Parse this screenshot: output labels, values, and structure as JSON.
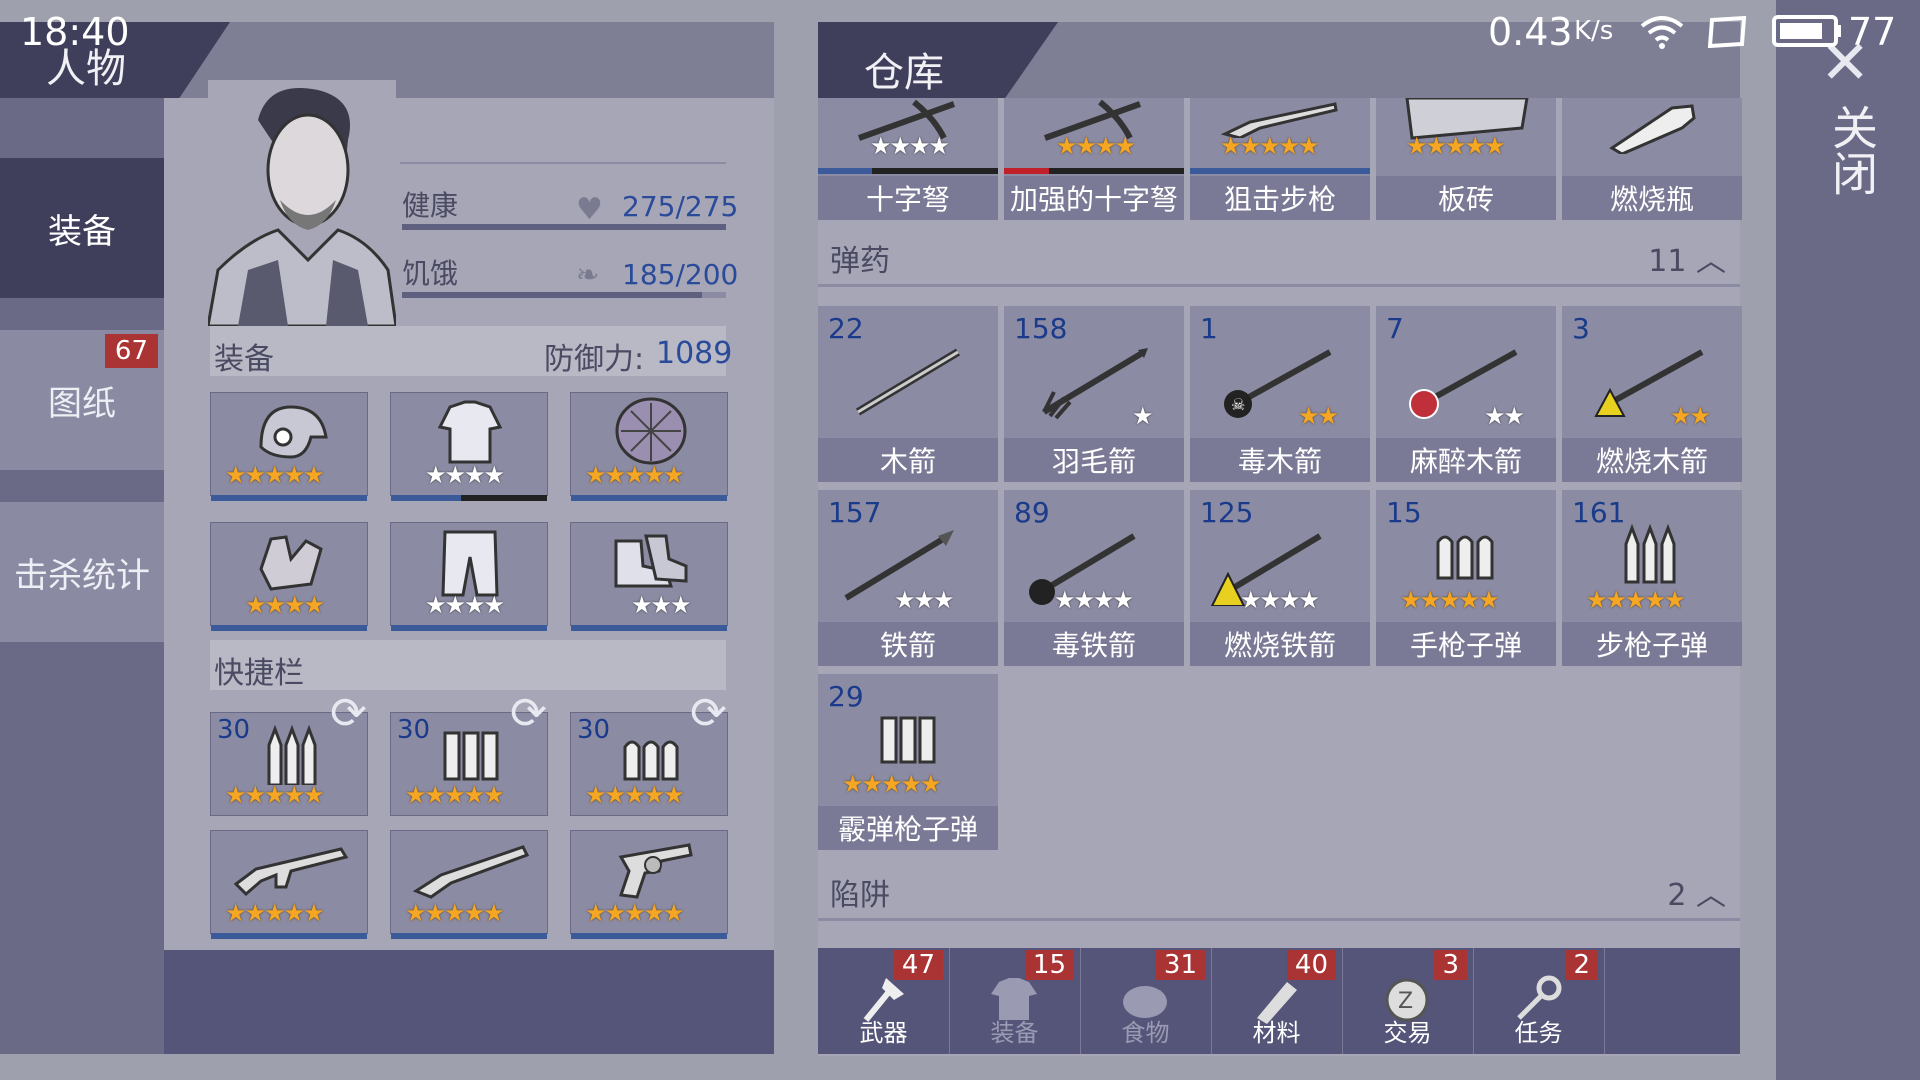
{
  "status_bar": {
    "time": "18:40",
    "speed": "0.43",
    "speed_unit": "K/s",
    "battery": "77"
  },
  "left": {
    "title": "人物",
    "tabs": [
      {
        "label": "装备",
        "badge": ""
      },
      {
        "label": "图纸",
        "badge": "67"
      },
      {
        "label": "击杀统计",
        "badge": ""
      }
    ],
    "health_label": "健康",
    "health_value": "275/275",
    "hunger_label": "饥饿",
    "hunger_value": "185/200",
    "equip_label": "装备",
    "defense_label": "防御力:",
    "defense_value": "1089",
    "equipment": [
      {
        "icon": "helmet-icon",
        "stars": "★★★★★",
        "gold": true
      },
      {
        "icon": "shirt-icon",
        "stars": "★★★★",
        "gold": false
      },
      {
        "icon": "shell-armor-icon",
        "stars": "★★★★★",
        "gold": true
      },
      {
        "icon": "gloves-icon",
        "stars": "★★★★",
        "gold": true
      },
      {
        "icon": "pants-icon",
        "stars": "★★★★",
        "gold": false
      },
      {
        "icon": "boots-icon",
        "stars": "★★★",
        "gold": false
      }
    ],
    "quickbar_label": "快捷栏",
    "quickbar": [
      {
        "count": "30",
        "icon": "rifle-bullets-icon",
        "stars": "★★★★★"
      },
      {
        "count": "30",
        "icon": "shotgun-shells-icon",
        "stars": "★★★★★"
      },
      {
        "count": "30",
        "icon": "pistol-bullets-icon",
        "stars": "★★★★★"
      },
      {
        "count": "",
        "icon": "assault-rifle-icon",
        "stars": "★★★★★"
      },
      {
        "count": "",
        "icon": "shotgun-icon",
        "stars": "★★★★★"
      },
      {
        "count": "",
        "icon": "revolver-icon",
        "stars": "★★★★★"
      }
    ]
  },
  "right": {
    "title": "仓库",
    "close_label": "关闭",
    "top_items": [
      {
        "label": "十字弩",
        "stars": "★★★★",
        "gold": false
      },
      {
        "label": "加强的十字弩",
        "stars": "★★★★",
        "gold": true
      },
      {
        "label": "狙击步枪",
        "stars": "★★★★★",
        "gold": true
      },
      {
        "label": "板砖",
        "stars": "★★★★★",
        "gold": true
      },
      {
        "label": "燃烧瓶",
        "stars": "",
        "gold": false
      }
    ],
    "ammo_label": "弹药",
    "ammo_count": "11",
    "ammo": [
      {
        "count": "22",
        "label": "木箭",
        "stars": "",
        "gold": false
      },
      {
        "count": "158",
        "label": "羽毛箭",
        "stars": "★",
        "gold": false
      },
      {
        "count": "1",
        "label": "毒木箭",
        "stars": "★★",
        "gold": true
      },
      {
        "count": "7",
        "label": "麻醉木箭",
        "stars": "★★",
        "gold": false
      },
      {
        "count": "3",
        "label": "燃烧木箭",
        "stars": "★★",
        "gold": true
      },
      {
        "count": "157",
        "label": "铁箭",
        "stars": "★★★",
        "gold": false
      },
      {
        "count": "89",
        "label": "毒铁箭",
        "stars": "★★★★",
        "gold": false
      },
      {
        "count": "125",
        "label": "燃烧铁箭",
        "stars": "★★★★",
        "gold": false
      },
      {
        "count": "15",
        "label": "手枪子弹",
        "stars": "★★★★★",
        "gold": true
      },
      {
        "count": "161",
        "label": "步枪子弹",
        "stars": "★★★★★",
        "gold": true
      },
      {
        "count": "29",
        "label": "霰弹枪子弹",
        "stars": "★★★★★",
        "gold": true
      }
    ],
    "traps_label": "陷阱",
    "traps_count": "2",
    "bottom_tabs": [
      {
        "label": "武器",
        "badge": "47",
        "dim": false
      },
      {
        "label": "装备",
        "badge": "15",
        "dim": true
      },
      {
        "label": "食物",
        "badge": "31",
        "dim": true
      },
      {
        "label": "材料",
        "badge": "40",
        "dim": false
      },
      {
        "label": "交易",
        "badge": "3",
        "dim": false
      },
      {
        "label": "任务",
        "badge": "2",
        "dim": false
      }
    ]
  }
}
